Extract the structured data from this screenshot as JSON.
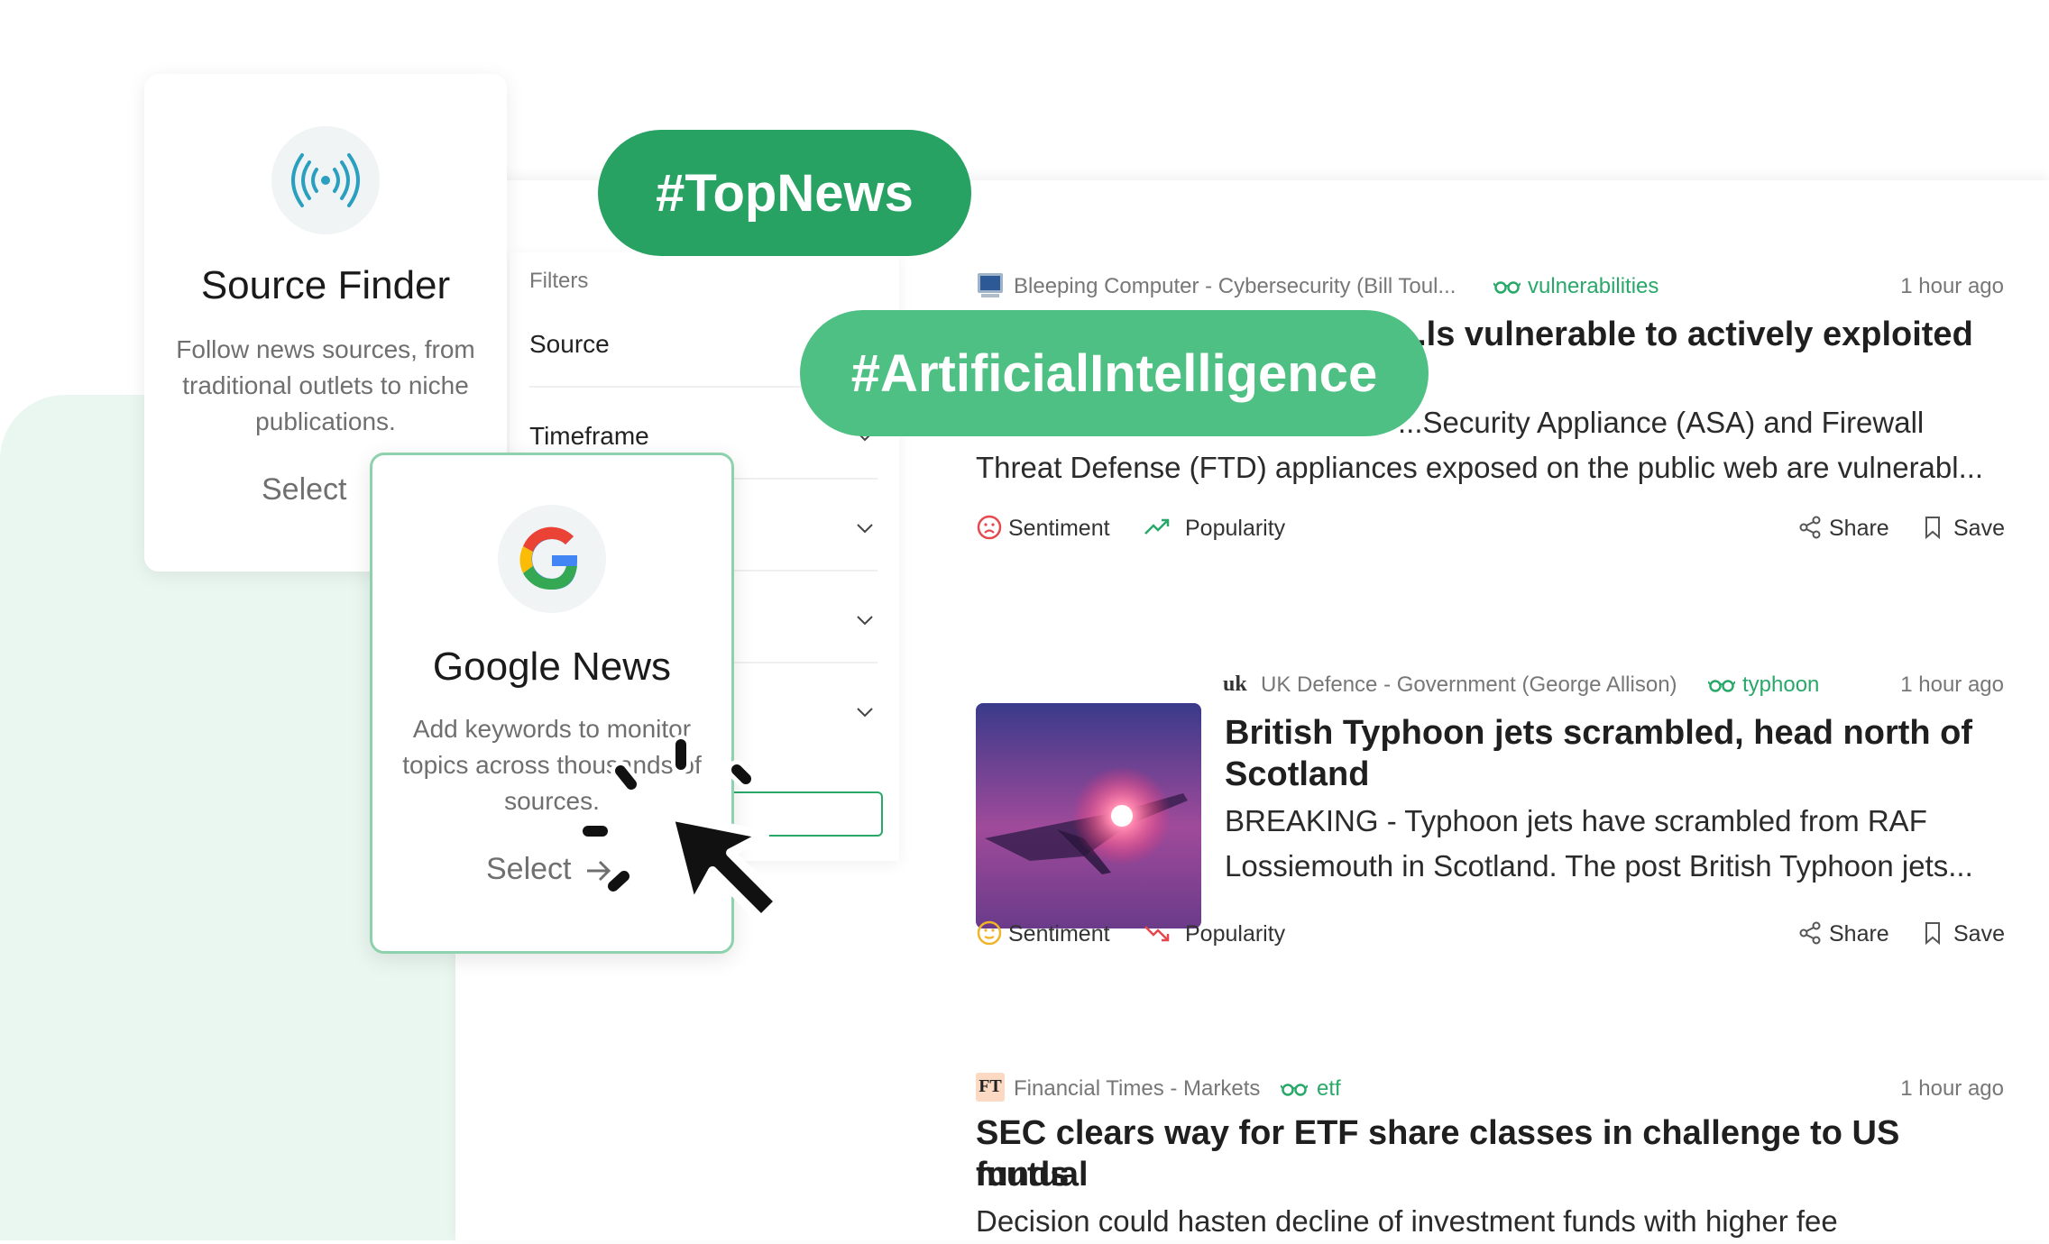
{
  "tags": {
    "top_news": "#TopNews",
    "ai": "#ArtificialIntelligence"
  },
  "source_card": {
    "icon": "broadcast-icon",
    "title": "Source Finder",
    "description": "Follow news sources, from traditional outlets to niche publications.",
    "select_label": "Select"
  },
  "google_card": {
    "icon": "google-icon",
    "title": "Google News",
    "description": "Add keywords to monitor topics across thousands of sources.",
    "select_label": "Select"
  },
  "filters": {
    "title": "Filters",
    "rows": [
      {
        "label": "Source"
      },
      {
        "label": "Timeframe"
      },
      {
        "label": ""
      },
      {
        "label": ""
      },
      {
        "label": ""
      }
    ]
  },
  "articles": [
    {
      "source": "Bleeping Computer - Cybersecurity (Bill Toul...",
      "keyword": "vulnerabilities",
      "time": "1 hour ago",
      "headline": "...ls vulnerable to actively exploited",
      "snippet_1": "...Security Appliance (ASA) and Firewall",
      "snippet_2": "Threat Defense (FTD) appliances exposed on the public web are vulnerabl...",
      "sentiment_label": "Sentiment",
      "popularity_label": "Popularity",
      "share_label": "Share",
      "save_label": "Save",
      "sentiment": "negative",
      "popularity": "rising"
    },
    {
      "source_prefix": "uk",
      "source": "UK Defence - Government (George Allison)",
      "keyword": "typhoon",
      "time": "1 hour ago",
      "headline_1": "British Typhoon jets scrambled, head north of",
      "headline_2": "Scotland",
      "snippet_1": "BREAKING - Typhoon jets have scrambled from RAF",
      "snippet_2": "Lossiemouth in Scotland. The post British Typhoon jets...",
      "sentiment_label": "Sentiment",
      "popularity_label": "Popularity",
      "share_label": "Share",
      "save_label": "Save",
      "sentiment": "neutral",
      "popularity": "falling"
    },
    {
      "source_prefix": "FT",
      "source": "Financial Times - Markets",
      "keyword": "etf",
      "time": "1 hour ago",
      "headline_1": "SEC clears way for ETF share classes in challenge to US mutual",
      "headline_2": "funds",
      "snippet_1": "Decision could hasten decline of investment funds with higher fee"
    }
  ],
  "colors": {
    "brand_green": "#27a263",
    "brand_green_light": "#4fc084",
    "mint_background": "#eaf7f0",
    "negative": "#e5484d",
    "neutral": "#f0b429",
    "keyword": "#2aa86a"
  }
}
